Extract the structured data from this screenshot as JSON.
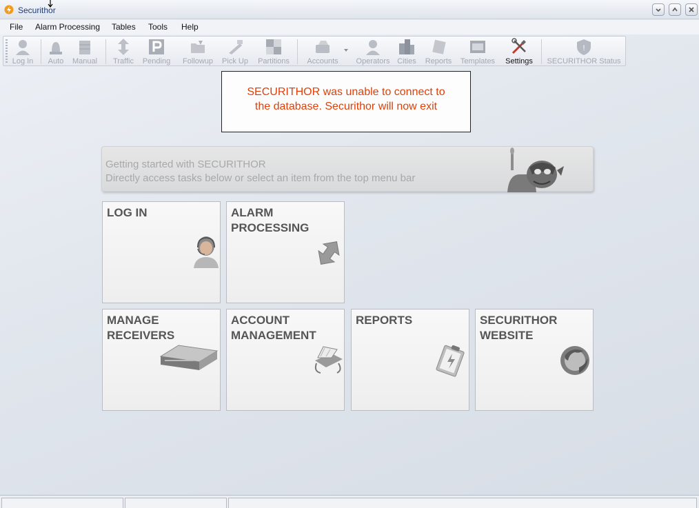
{
  "window": {
    "title": "Securithor"
  },
  "menu": [
    "File",
    "Alarm Processing",
    "Tables",
    "Tools",
    "Help"
  ],
  "toolbar": {
    "items": [
      {
        "label": "Log In",
        "icon": "user-icon",
        "enabled": false
      },
      {
        "label": "Auto",
        "icon": "alarm-light-icon",
        "enabled": false
      },
      {
        "label": "Manual",
        "icon": "cabinet-icon",
        "enabled": false
      },
      {
        "label": "Traffic",
        "icon": "arrows-icon",
        "enabled": false
      },
      {
        "label": "Pending",
        "icon": "p-box-icon",
        "enabled": false
      },
      {
        "label": "Followup",
        "icon": "folder-icon",
        "enabled": false
      },
      {
        "label": "Pick Up",
        "icon": "pickup-icon",
        "enabled": false
      },
      {
        "label": "Partitions",
        "icon": "grid-icon",
        "enabled": false
      },
      {
        "label": "Accounts",
        "icon": "card-file-icon",
        "enabled": false
      },
      {
        "label": "Operators",
        "icon": "operator-icon",
        "enabled": false
      },
      {
        "label": "Cities",
        "icon": "city-icon",
        "enabled": false
      },
      {
        "label": "Reports",
        "icon": "report-icon",
        "enabled": false
      },
      {
        "label": "Templates",
        "icon": "template-icon",
        "enabled": false
      },
      {
        "label": "Settings",
        "icon": "tools-icon",
        "enabled": true
      },
      {
        "label": "SECURITHOR Status",
        "icon": "shield-icon",
        "enabled": false
      }
    ]
  },
  "alert": {
    "line1": "SECURITHOR was unable to connect to",
    "line2": "the database. Securithor will now exit"
  },
  "banner": {
    "line1": "Getting started with SECURITHOR",
    "line2": "Directly access tasks below or select an item from the top menu bar"
  },
  "tiles": [
    {
      "label": "LOG IN",
      "icon": "operator-icon"
    },
    {
      "label": "ALARM\nPROCESSING",
      "icon": "arrows-icon"
    },
    {
      "label": "MANAGE\nRECEIVERS",
      "icon": "receiver-icon"
    },
    {
      "label": "ACCOUNT\nMANAGEMENT",
      "icon": "card-file-icon"
    },
    {
      "label": "REPORTS",
      "icon": "clipboard-icon"
    },
    {
      "label": "SECURITHOR\nWEBSITE",
      "icon": "globe-icon"
    }
  ],
  "colors": {
    "alert_text": "#e04008",
    "title_text": "#1f3b78"
  }
}
